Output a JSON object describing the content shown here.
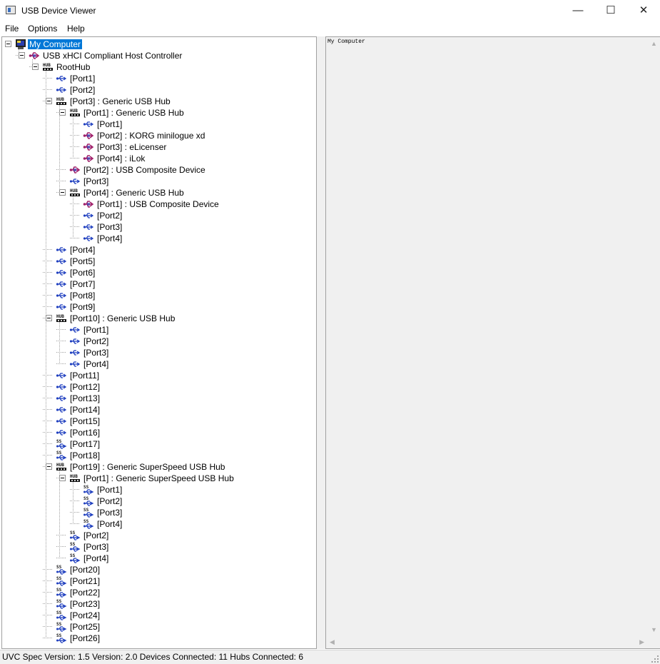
{
  "window": {
    "title": "USB Device Viewer",
    "minimize_glyph": "—",
    "maximize_glyph": "☐",
    "close_glyph": "✕"
  },
  "menu": {
    "items": [
      "File",
      "Options",
      "Help"
    ]
  },
  "tree": {
    "rows": [
      {
        "level": 0,
        "icon": "computer-icon",
        "text": "My Computer",
        "expander": true,
        "selected": true
      },
      {
        "level": 1,
        "icon": "usb-host-controller-icon",
        "text": "USB xHCI Compliant Host Controller",
        "expander": true
      },
      {
        "level": 2,
        "icon": "hub-icon",
        "text": "RootHub",
        "expander": true
      },
      {
        "level": 3,
        "icon": "usb-port-icon",
        "text": "[Port1]"
      },
      {
        "level": 3,
        "icon": "usb-port-icon",
        "text": "[Port2]"
      },
      {
        "level": 3,
        "icon": "hub-icon",
        "text": "[Port3]  :  Generic USB Hub",
        "expander": true
      },
      {
        "level": 4,
        "icon": "hub-icon",
        "text": "[Port1]  :  Generic USB Hub",
        "expander": true
      },
      {
        "level": 5,
        "icon": "usb-port-icon",
        "text": "[Port1]"
      },
      {
        "level": 5,
        "icon": "usb-device-icon",
        "text": "[Port2]  :  KORG minilogue xd"
      },
      {
        "level": 5,
        "icon": "usb-device-icon",
        "text": "[Port3]  :  eLicenser"
      },
      {
        "level": 5,
        "icon": "usb-device-icon",
        "text": "[Port4]  :  iLok"
      },
      {
        "level": 4,
        "icon": "usb-device-icon",
        "text": "[Port2]  :  USB Composite Device"
      },
      {
        "level": 4,
        "icon": "usb-port-icon",
        "text": "[Port3]"
      },
      {
        "level": 4,
        "icon": "hub-icon",
        "text": "[Port4]  :  Generic USB Hub",
        "expander": true
      },
      {
        "level": 5,
        "icon": "usb-device-icon",
        "text": "[Port1]  :  USB Composite Device"
      },
      {
        "level": 5,
        "icon": "usb-port-icon",
        "text": "[Port2]"
      },
      {
        "level": 5,
        "icon": "usb-port-icon",
        "text": "[Port3]"
      },
      {
        "level": 5,
        "icon": "usb-port-icon",
        "text": "[Port4]"
      },
      {
        "level": 3,
        "icon": "usb-port-icon",
        "text": "[Port4]"
      },
      {
        "level": 3,
        "icon": "usb-port-icon",
        "text": "[Port5]"
      },
      {
        "level": 3,
        "icon": "usb-port-icon",
        "text": "[Port6]"
      },
      {
        "level": 3,
        "icon": "usb-port-icon",
        "text": "[Port7]"
      },
      {
        "level": 3,
        "icon": "usb-port-icon",
        "text": "[Port8]"
      },
      {
        "level": 3,
        "icon": "usb-port-icon",
        "text": "[Port9]"
      },
      {
        "level": 3,
        "icon": "hub-icon",
        "text": "[Port10]  :  Generic USB Hub",
        "expander": true
      },
      {
        "level": 4,
        "icon": "usb-port-icon",
        "text": "[Port1]"
      },
      {
        "level": 4,
        "icon": "usb-port-icon",
        "text": "[Port2]"
      },
      {
        "level": 4,
        "icon": "usb-port-icon",
        "text": "[Port3]"
      },
      {
        "level": 4,
        "icon": "usb-port-icon",
        "text": "[Port4]"
      },
      {
        "level": 3,
        "icon": "usb-port-icon",
        "text": "[Port11]"
      },
      {
        "level": 3,
        "icon": "usb-port-icon",
        "text": "[Port12]"
      },
      {
        "level": 3,
        "icon": "usb-port-icon",
        "text": "[Port13]"
      },
      {
        "level": 3,
        "icon": "usb-port-icon",
        "text": "[Port14]"
      },
      {
        "level": 3,
        "icon": "usb-port-icon",
        "text": "[Port15]"
      },
      {
        "level": 3,
        "icon": "usb-port-icon",
        "text": "[Port16]"
      },
      {
        "level": 3,
        "icon": "superspeed-port-icon",
        "text": "[Port17]"
      },
      {
        "level": 3,
        "icon": "superspeed-port-icon",
        "text": "[Port18]"
      },
      {
        "level": 3,
        "icon": "hub-icon",
        "text": "[Port19]  :  Generic SuperSpeed USB Hub",
        "expander": true
      },
      {
        "level": 4,
        "icon": "hub-icon",
        "text": "[Port1]  :  Generic SuperSpeed USB Hub",
        "expander": true
      },
      {
        "level": 5,
        "icon": "superspeed-port-icon",
        "text": "[Port1]"
      },
      {
        "level": 5,
        "icon": "superspeed-port-icon",
        "text": "[Port2]"
      },
      {
        "level": 5,
        "icon": "superspeed-port-icon",
        "text": "[Port3]"
      },
      {
        "level": 5,
        "icon": "superspeed-port-icon",
        "text": "[Port4]"
      },
      {
        "level": 4,
        "icon": "superspeed-port-icon",
        "text": "[Port2]"
      },
      {
        "level": 4,
        "icon": "superspeed-port-icon",
        "text": "[Port3]"
      },
      {
        "level": 4,
        "icon": "superspeed-port-icon",
        "text": "[Port4]"
      },
      {
        "level": 3,
        "icon": "superspeed-port-icon",
        "text": "[Port20]"
      },
      {
        "level": 3,
        "icon": "superspeed-port-icon",
        "text": "[Port21]"
      },
      {
        "level": 3,
        "icon": "superspeed-port-icon",
        "text": "[Port22]"
      },
      {
        "level": 3,
        "icon": "superspeed-port-icon",
        "text": "[Port23]"
      },
      {
        "level": 3,
        "icon": "superspeed-port-icon",
        "text": "[Port24]"
      },
      {
        "level": 3,
        "icon": "superspeed-port-icon",
        "text": "[Port25]"
      },
      {
        "level": 3,
        "icon": "superspeed-port-icon",
        "text": "[Port26]"
      }
    ]
  },
  "detail": {
    "text": "My Computer"
  },
  "status": {
    "text": "UVC Spec Version: 1.5 Version: 2.0 Devices Connected: 11   Hubs Connected: 6"
  },
  "colors": {
    "selection": "#0078d7",
    "usb_blue": "#1f3fbf",
    "device_magenta": "#a0206a"
  }
}
